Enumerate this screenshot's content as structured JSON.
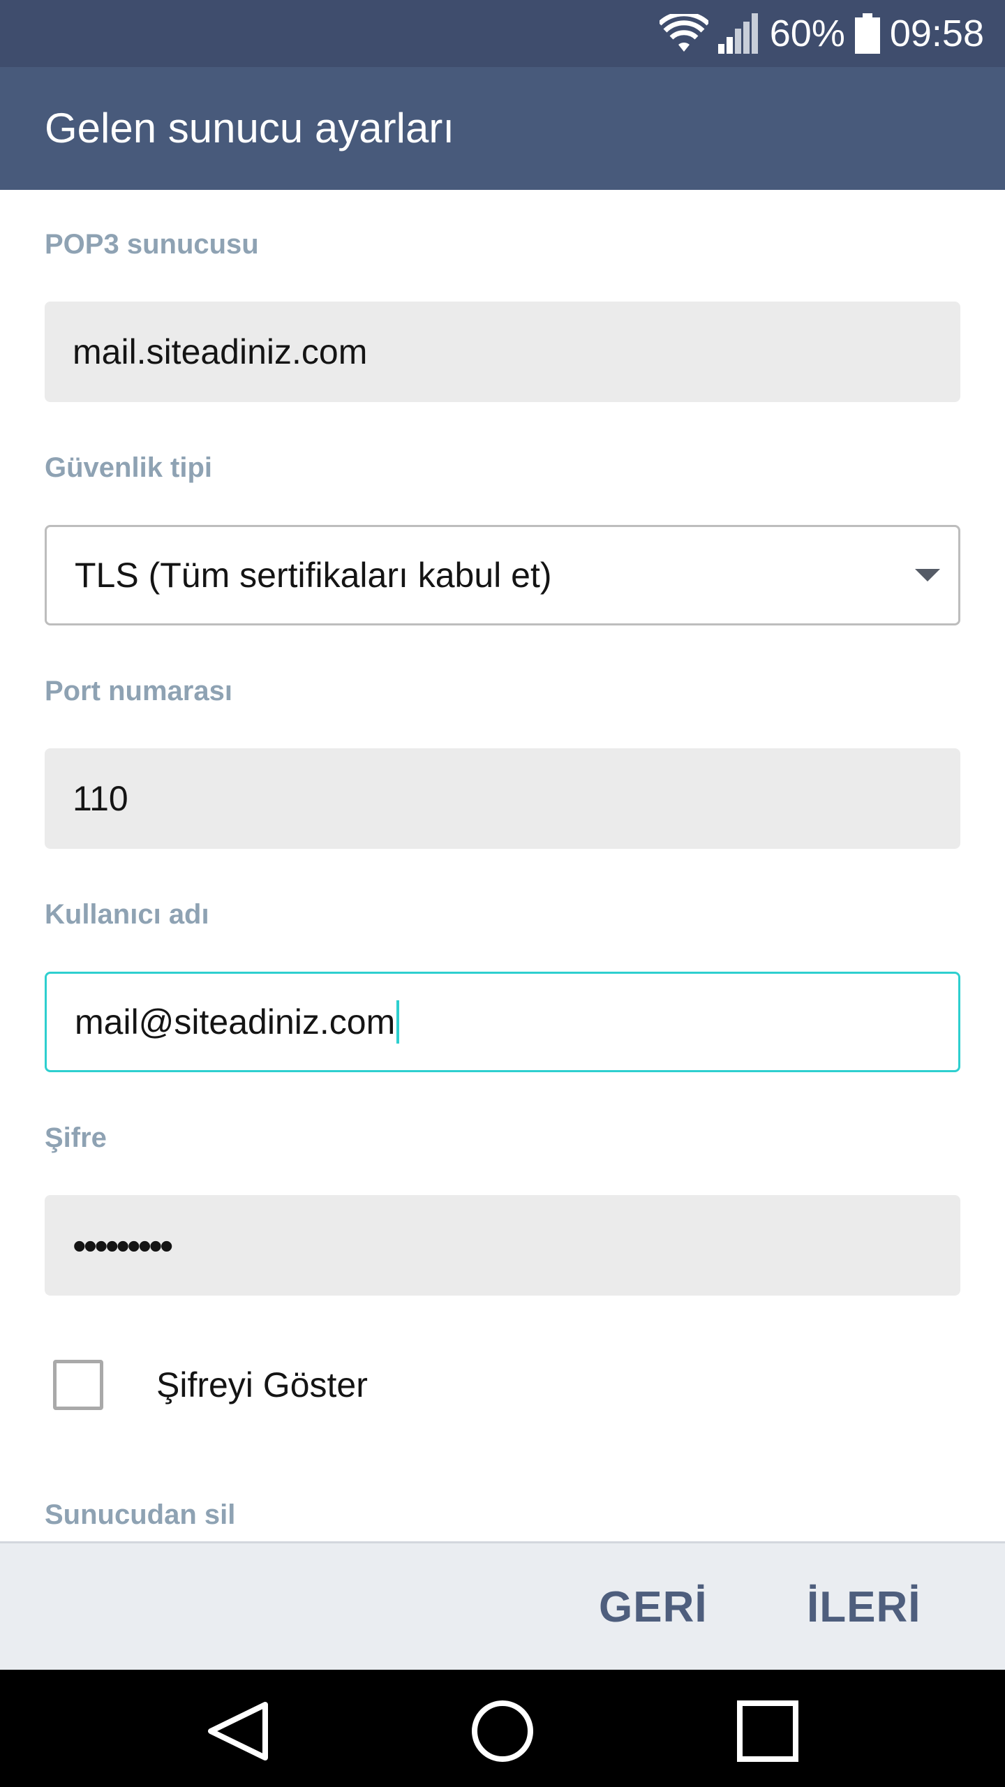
{
  "status_bar": {
    "battery_percent": "60%",
    "time": "09:58",
    "icons": [
      "wifi-icon",
      "signal-icon",
      "battery-icon"
    ]
  },
  "app_bar": {
    "title": "Gelen sunucu ayarları"
  },
  "form": {
    "server": {
      "label": "POP3 sunucusu",
      "value": "mail.siteadiniz.com"
    },
    "security": {
      "label": "Güvenlik tipi",
      "value": "TLS (Tüm sertifikaları kabul et)"
    },
    "port": {
      "label": "Port numarası",
      "value": "110"
    },
    "username": {
      "label": "Kullanıcı adı",
      "value": "mail@siteadiniz.com"
    },
    "password": {
      "label": "Şifre",
      "value": "•••••••••"
    },
    "show_password": {
      "label": "Şifreyi Göster",
      "checked": false
    },
    "delete_from_server": {
      "label": "Sunucudan sil"
    }
  },
  "actions": {
    "back": "GERİ",
    "next": "İLERİ"
  },
  "nav_bar": {
    "icons": [
      "back-triangle-icon",
      "home-circle-icon",
      "recents-square-icon"
    ]
  },
  "colors": {
    "status_bar": "#3f4d6d",
    "app_bar": "#485a7b",
    "label": "#8ea2b3",
    "field_bg": "#ebebeb",
    "focus_accent": "#2ecfcf",
    "action_text": "#4e5e7d"
  }
}
